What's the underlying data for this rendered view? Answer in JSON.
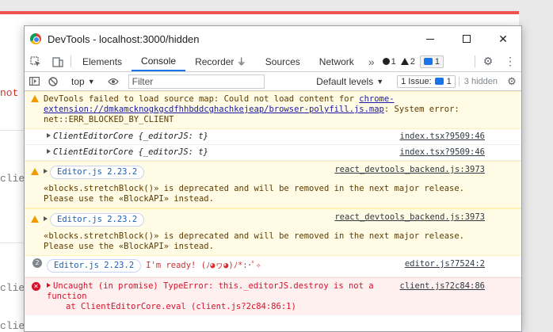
{
  "background_page": {
    "frag_red": "not a",
    "frag_1": "client.js",
    "frag_2": "client.js",
    "frag_3": "client.js"
  },
  "window": {
    "title": "DevTools - localhost:3000/hidden"
  },
  "tabs": [
    {
      "label": "Elements"
    },
    {
      "label": "Console"
    },
    {
      "label": "Recorder ⏚"
    },
    {
      "label": "Sources"
    },
    {
      "label": "Network"
    }
  ],
  "counters": {
    "errors": "1",
    "warnings": "2",
    "issues": "1"
  },
  "console_toolbar": {
    "context": "top",
    "filter_placeholder": "Filter",
    "levels": "Default levels",
    "issue_label": "1 Issue:",
    "issue_count": "1",
    "hidden": "3 hidden"
  },
  "messages": [
    {
      "type": "warning",
      "line1": "DevTools failed to load source map: Could not load content for ",
      "link1": "chrome-extension://dmkamcknogkgcdfhhbddcghachkejeap/browser-polyfill.js.map",
      "line1b": ": System error:",
      "line2": "net::ERR_BLOCKED_BY_CLIENT"
    },
    {
      "type": "log",
      "text": "ClientEditorCore {_editorJS: t}",
      "source": "index.tsx?9509:46"
    },
    {
      "type": "log",
      "text": "ClientEditorCore {_editorJS: t}",
      "source": "index.tsx?9509:46"
    },
    {
      "type": "warning",
      "tag": "Editor.js 2.23.2",
      "source": "react_devtools_backend.js:3973",
      "line1": "«blocks.stretchBlock()» is deprecated and will be removed in the next major release.",
      "line2": "Please use the «BlockAPI» instead."
    },
    {
      "type": "warning",
      "tag": "Editor.js 2.23.2",
      "source": "react_devtools_backend.js:3973",
      "line1": "«blocks.stretchBlock()» is deprecated and will be removed in the next major release.",
      "line2": "Please use the «BlockAPI» instead."
    },
    {
      "type": "log",
      "repeat": "2",
      "tag": "Editor.js 2.23.2",
      "text": "I'm ready! (ﾉ◕ヮ◕)ﾉ*:･ﾟ✧",
      "source": "editor.js?7524:2"
    },
    {
      "type": "error",
      "line1": "Uncaught (in promise) TypeError: this._editorJS.destroy is not a",
      "line2": "function",
      "line3": "at ClientEditorCore.eval (client.js?2c84:86:1)",
      "source": "client.js?2c84:86"
    }
  ]
}
